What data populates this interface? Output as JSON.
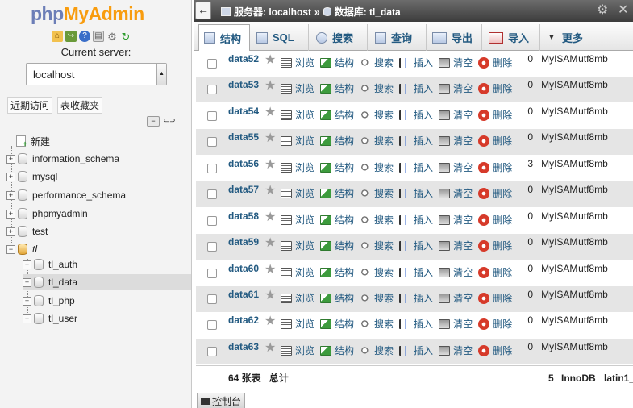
{
  "logo": {
    "part1": "php",
    "part2": "MyAdmin"
  },
  "quick_icons": [
    "home-icon",
    "logout-icon",
    "help-icon",
    "docs-icon",
    "settings-icon",
    "reload-icon"
  ],
  "current_server_label": "Current server:",
  "server_select_value": "localhost",
  "left_tabs": [
    "近期访问",
    "表收藏夹"
  ],
  "tree": {
    "new": "新建",
    "databases": [
      "information_schema",
      "mysql",
      "performance_schema",
      "phpmyadmin",
      "test",
      "tl"
    ],
    "tables": [
      "tl_auth",
      "tl_data",
      "tl_php",
      "tl_user"
    ],
    "selected_table": "tl_data"
  },
  "breadcrumb": {
    "server": "服务器: localhost",
    "sep": "»",
    "database": "数据库: tl_data"
  },
  "menu_tabs": [
    "结构",
    "SQL",
    "搜索",
    "查询",
    "导出",
    "导入",
    "更多"
  ],
  "actions": {
    "browse": "浏览",
    "structure": "结构",
    "search": "搜索",
    "insert": "插入",
    "empty": "清空",
    "drop": "删除"
  },
  "rows": [
    {
      "name": "data52",
      "rows": "0",
      "engine": "MyISAM",
      "collation": "utf8mb"
    },
    {
      "name": "data53",
      "rows": "0",
      "engine": "MyISAM",
      "collation": "utf8mb"
    },
    {
      "name": "data54",
      "rows": "0",
      "engine": "MyISAM",
      "collation": "utf8mb"
    },
    {
      "name": "data55",
      "rows": "0",
      "engine": "MyISAM",
      "collation": "utf8mb"
    },
    {
      "name": "data56",
      "rows": "3",
      "engine": "MyISAM",
      "collation": "utf8mb"
    },
    {
      "name": "data57",
      "rows": "0",
      "engine": "MyISAM",
      "collation": "utf8mb"
    },
    {
      "name": "data58",
      "rows": "0",
      "engine": "MyISAM",
      "collation": "utf8mb"
    },
    {
      "name": "data59",
      "rows": "0",
      "engine": "MyISAM",
      "collation": "utf8mb"
    },
    {
      "name": "data60",
      "rows": "0",
      "engine": "MyISAM",
      "collation": "utf8mb"
    },
    {
      "name": "data61",
      "rows": "0",
      "engine": "MyISAM",
      "collation": "utf8mb"
    },
    {
      "name": "data62",
      "rows": "0",
      "engine": "MyISAM",
      "collation": "utf8mb"
    },
    {
      "name": "data63",
      "rows": "0",
      "engine": "MyISAM",
      "collation": "utf8mb"
    }
  ],
  "summary": {
    "tables": "64 张表",
    "total": "总计",
    "rows": "5",
    "engine": "InnoDB",
    "collation": "latin1_"
  },
  "console_label": "控制台"
}
